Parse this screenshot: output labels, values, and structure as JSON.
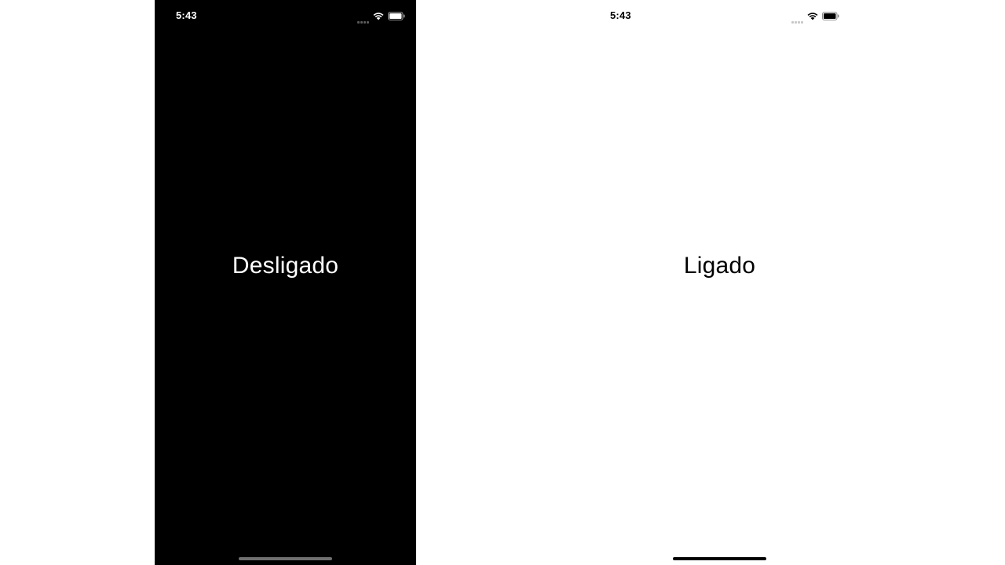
{
  "screens": [
    {
      "theme": "dark",
      "status_bar": {
        "time": "5:43",
        "icons": [
          "cellular-signal-icon",
          "wifi-icon",
          "battery-icon"
        ]
      },
      "label": "Desligado",
      "background": "#000000",
      "text_color": "#ffffff"
    },
    {
      "theme": "light",
      "status_bar": {
        "time": "5:43",
        "icons": [
          "cellular-signal-icon",
          "wifi-icon",
          "battery-icon"
        ]
      },
      "label": "Ligado",
      "background": "#ffffff",
      "text_color": "#000000"
    }
  ]
}
